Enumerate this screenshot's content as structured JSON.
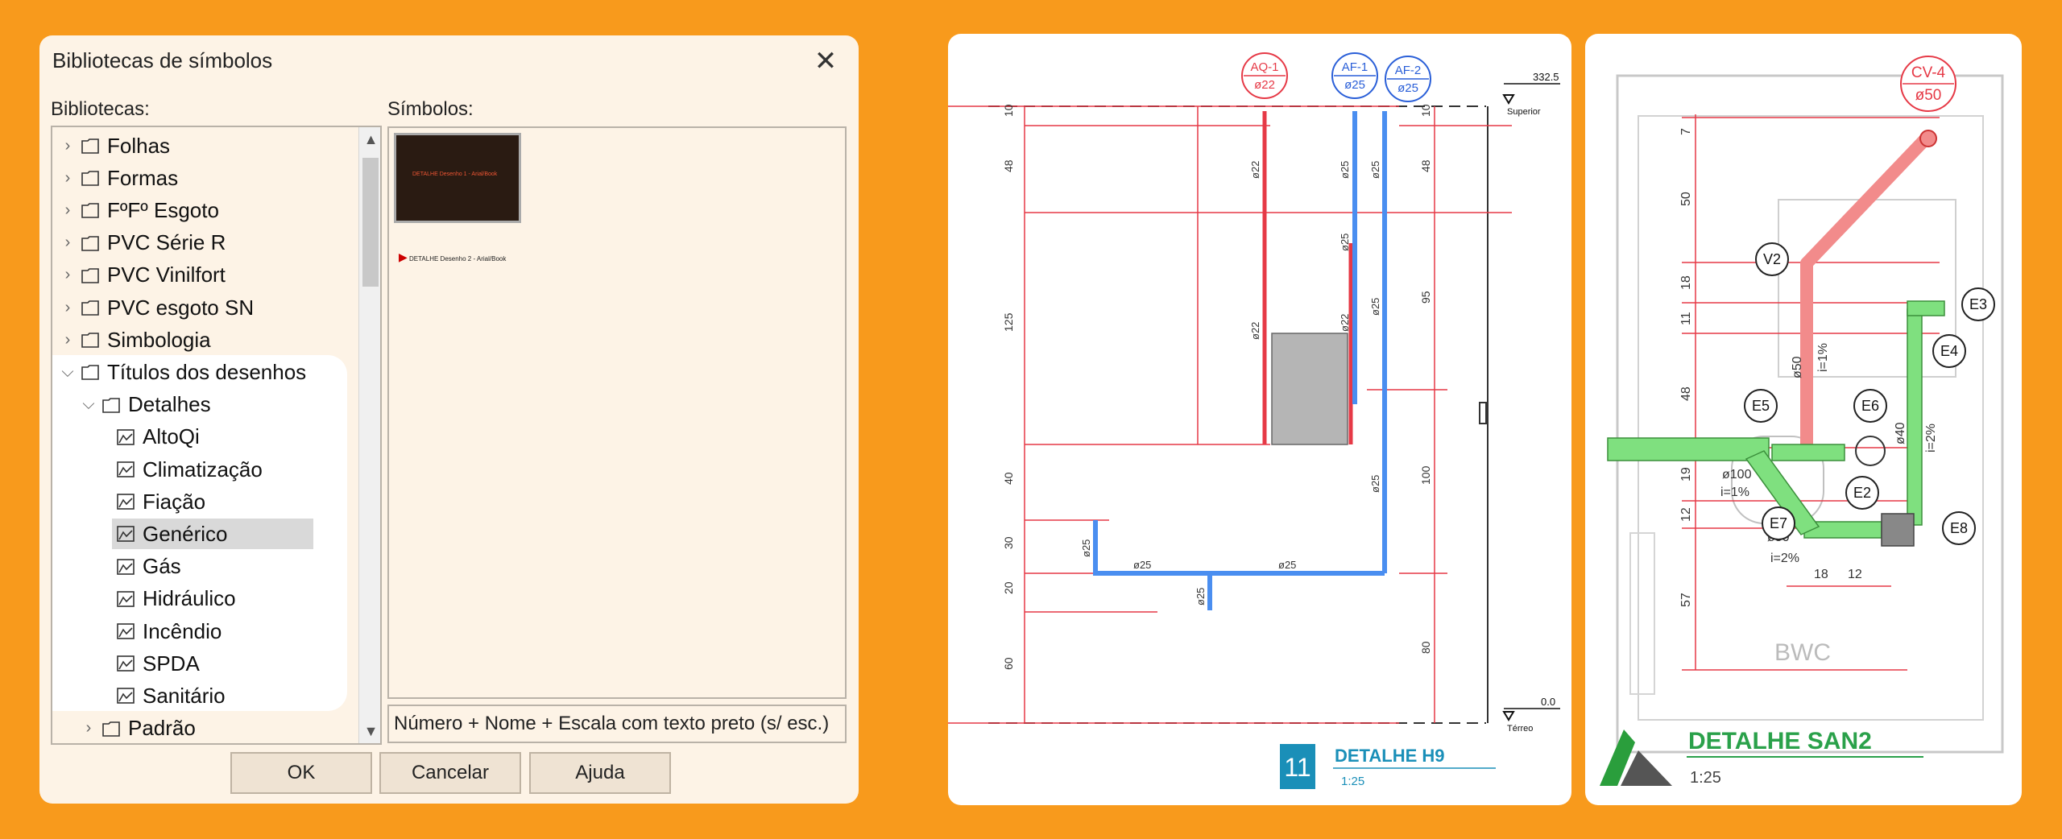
{
  "dialog": {
    "title": "Bibliotecas de símbolos",
    "libraries_label": "Bibliotecas:",
    "symbols_label": "Símbolos:",
    "tree": [
      {
        "label": "Folhas",
        "level": 0,
        "type": "folder",
        "expanded": false
      },
      {
        "label": "Formas",
        "level": 0,
        "type": "folder",
        "expanded": false
      },
      {
        "label": "FºFº Esgoto",
        "level": 0,
        "type": "folder",
        "expanded": false
      },
      {
        "label": "PVC Série R",
        "level": 0,
        "type": "folder",
        "expanded": false
      },
      {
        "label": "PVC Vinilfort",
        "level": 0,
        "type": "folder",
        "expanded": false
      },
      {
        "label": "PVC esgoto SN",
        "level": 0,
        "type": "folder",
        "expanded": false
      },
      {
        "label": "Simbologia",
        "level": 0,
        "type": "folder",
        "expanded": false
      },
      {
        "label": "Títulos dos desenhos",
        "level": 0,
        "type": "folder",
        "expanded": true
      },
      {
        "label": "Detalhes",
        "level": 1,
        "type": "folder",
        "expanded": true
      },
      {
        "label": "AltoQi",
        "level": 2,
        "type": "item"
      },
      {
        "label": "Climatização",
        "level": 2,
        "type": "item"
      },
      {
        "label": "Fiação",
        "level": 2,
        "type": "item"
      },
      {
        "label": "Genérico",
        "level": 2,
        "type": "item",
        "selected": true
      },
      {
        "label": "Gás",
        "level": 2,
        "type": "item"
      },
      {
        "label": "Hidráulico",
        "level": 2,
        "type": "item"
      },
      {
        "label": "Incêndio",
        "level": 2,
        "type": "item"
      },
      {
        "label": "SPDA",
        "level": 2,
        "type": "item"
      },
      {
        "label": "Sanitário",
        "level": 2,
        "type": "item"
      },
      {
        "label": "Padrão",
        "level": 1,
        "type": "folder",
        "expanded": false
      }
    ],
    "symbol1_text": "DETALHE Desenho 1 - Arial/Book",
    "symbol2_text": "DETALHE Desenho 2 - Arial/Book",
    "description": "Número + Nome + Escala com texto preto (s/ esc.)",
    "buttons": {
      "ok": "OK",
      "cancel": "Cancelar",
      "help": "Ajuda"
    }
  },
  "drawing_h9": {
    "tags": [
      {
        "code": "AQ-1",
        "diam": "ø22",
        "color": "#e63946"
      },
      {
        "code": "AF-1",
        "diam": "ø25",
        "color": "#2a5fd8"
      },
      {
        "code": "AF-2",
        "diam": "ø25",
        "color": "#2a5fd8"
      }
    ],
    "level_top_value": "332.5",
    "level_top_name": "Superior",
    "level_bottom_value": "0.0",
    "level_bottom_name": "Térreo",
    "left_dims": [
      "10",
      "48",
      "125",
      "40",
      "30",
      "20",
      "60"
    ],
    "right_dims": [
      "10",
      "48",
      "95",
      "100",
      "80"
    ],
    "pipe_labels": [
      "ø22",
      "ø22",
      "ø25",
      "ø25",
      "ø25",
      "ø22",
      "ø25",
      "ø25",
      "ø25",
      "ø25",
      "ø25",
      "ø25"
    ],
    "title_number": "11",
    "title": "DETALHE H9",
    "scale": "1:25"
  },
  "drawing_san2": {
    "tag_code": "CV-4",
    "tag_diam": "ø50",
    "nodes": [
      "V2",
      "E3",
      "E4",
      "E5",
      "E6",
      "E2",
      "E7",
      "E8"
    ],
    "left_dims": [
      "7",
      "50",
      "18",
      "11",
      "48",
      "19",
      "12",
      "57"
    ],
    "bottom_dims": [
      "18",
      "12"
    ],
    "labels": {
      "d50_vert": "ø50",
      "slope_vert": "i=1%",
      "d40": "ø40",
      "slope_e": "i=2%",
      "d100": "ø100",
      "slope_100": "i=1%",
      "d50_bot": "ø50",
      "slope_bot": "i=2%"
    },
    "room": "BWC",
    "title": "DETALHE SAN2",
    "scale": "1:25",
    "colors": {
      "sewer_green": "#7fe07f",
      "vent_red": "#f28b8b"
    }
  }
}
